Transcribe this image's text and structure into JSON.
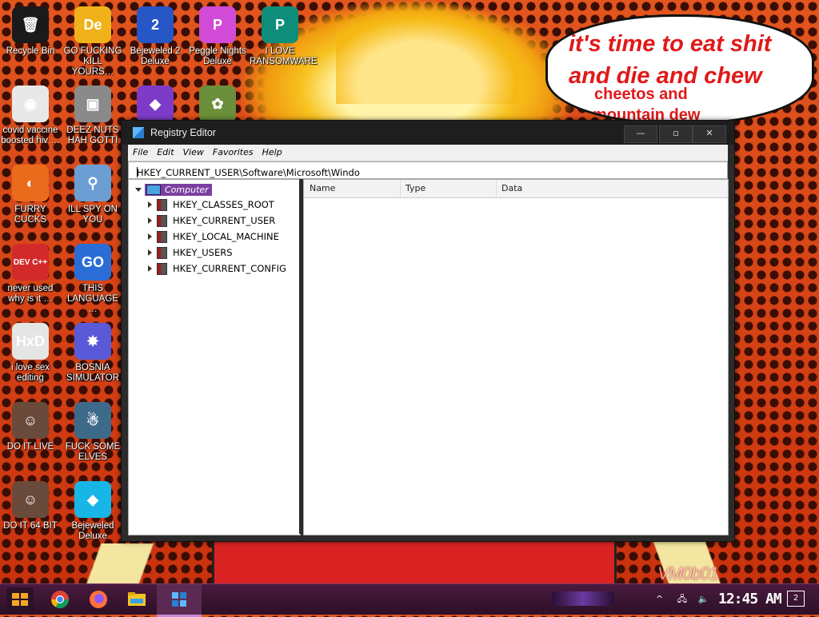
{
  "desktop": {
    "speech_bubble": [
      "it's time to eat shit",
      "and die and chew",
      "cheetos and",
      "mountain dew"
    ],
    "watermark": "VM0b01",
    "icons": [
      {
        "label": "Recycle Bin",
        "glyph": "🗑",
        "color": "#1a1a1a"
      },
      {
        "label": "GO FUCKING KILL YOURS…",
        "glyph": "De",
        "color": "#f0b21a"
      },
      {
        "label": "Bejeweled 2 Deluxe",
        "glyph": "2",
        "color": "#2756c7"
      },
      {
        "label": "Peggle Nights Deluxe",
        "glyph": "P",
        "color": "#d24bd6"
      },
      {
        "label": "I LOVE RANSOMWARE",
        "glyph": "P",
        "color": "#0e8e7a"
      },
      {
        "label": "covid vaccine boosted hiv …",
        "glyph": "◉",
        "color": "#e8e8e8"
      },
      {
        "label": "DEEZ NUTS HAH GOTTI",
        "glyph": "▣",
        "color": "#8a8a8a"
      },
      {
        "label": "",
        "glyph": "◆",
        "color": "#7d3bc8"
      },
      {
        "label": "",
        "glyph": "✿",
        "color": "#6b8f3a"
      },
      {
        "label": "FURRY CUCKS",
        "glyph": "◐",
        "color": "#ea6b1c"
      },
      {
        "label": "ILL SPY ON YOU",
        "glyph": "⚲",
        "color": "#6b9fd4"
      },
      {
        "label": "never used why is it …",
        "glyph": "DEV C++",
        "color": "#d22a2a"
      },
      {
        "label": "THIS LANGUAGE …",
        "glyph": "GO",
        "color": "#2a6dd6"
      },
      {
        "label": "i love sex editing",
        "glyph": "HxD",
        "color": "#e5e5e5"
      },
      {
        "label": "BOSNIA SIMULATOR",
        "glyph": "✸",
        "color": "#5a5ad8"
      },
      {
        "label": "DO IT LIVE",
        "glyph": "☺",
        "color": "#6a4a3a"
      },
      {
        "label": "FUCK SOME ELVES",
        "glyph": "☃",
        "color": "#3e6a8a"
      },
      {
        "label": "DO IT 64 BIT",
        "glyph": "☺",
        "color": "#6a4a3a"
      },
      {
        "label": "Bejeweled Deluxe",
        "glyph": "◆",
        "color": "#17b6e6"
      }
    ]
  },
  "window": {
    "title": "Registry Editor",
    "buttons": {
      "minimize": "—",
      "maximize": "▫",
      "close": "✕"
    },
    "menu": [
      "File",
      "Edit",
      "View",
      "Favorites",
      "Help"
    ],
    "address": "HKEY_CURRENT_USER\\Software\\Microsoft\\Windo",
    "tree_root": "Computer",
    "hives": [
      "HKEY_CLASSES_ROOT",
      "HKEY_CURRENT_USER",
      "HKEY_LOCAL_MACHINE",
      "HKEY_USERS",
      "HKEY_CURRENT_CONFIG"
    ],
    "columns": [
      "Name",
      "Type",
      "Data"
    ]
  },
  "taskbar": {
    "clock": "12:45 AM",
    "notification_count": "2",
    "tray": [
      "network-icon",
      "volume-icon"
    ]
  }
}
